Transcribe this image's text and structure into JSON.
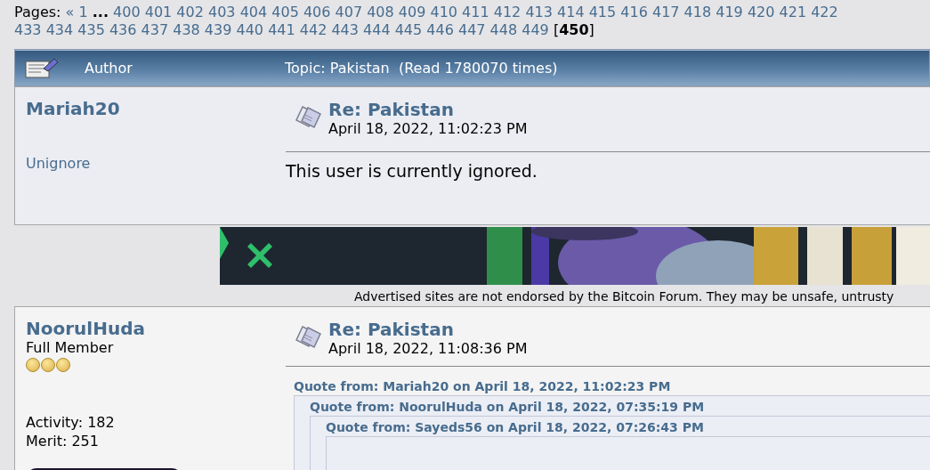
{
  "pagination": {
    "label": "Pages:",
    "first_link": "«",
    "lines": [
      [
        "1",
        "...",
        "400",
        "401",
        "402",
        "403",
        "404",
        "405",
        "406",
        "407",
        "408",
        "409",
        "410",
        "411",
        "412",
        "413",
        "414",
        "415",
        "416",
        "417",
        "418",
        "419",
        "420",
        "421",
        "422"
      ],
      [
        "433",
        "434",
        "435",
        "436",
        "437",
        "438",
        "439",
        "440",
        "441",
        "442",
        "443",
        "444",
        "445",
        "446",
        "447",
        "448",
        "449"
      ]
    ],
    "current": "[**450**]"
  },
  "topic_header": {
    "author_label": "Author",
    "topic": "Topic: Pakistan  (Read 1780070 times)"
  },
  "posts": [
    {
      "kind": "ignored",
      "author": "Mariah20",
      "unignore": "Unignore",
      "subject": "Re: Pakistan",
      "date": "April 18, 2022, 11:02:23 PM",
      "body": "This user is currently ignored."
    },
    {
      "kind": "full",
      "author": "NoorulHuda",
      "rank": "Full Member",
      "stars": 3,
      "activity": "Activity: 182",
      "merit": "Merit: 251",
      "subject": "Re: Pakistan",
      "date": "April 18, 2022, 11:08:36 PM",
      "quotes": [
        "Quote from: Mariah20 on April 18, 2022, 11:02:23 PM",
        "Quote from: NoorulHuda on April 18, 2022, 07:35:19 PM",
        "Quote from: Sayeds56 on April 18, 2022, 07:26:43 PM"
      ]
    }
  ],
  "ad": {
    "kind": "picture",
    "disclaimer": "Advertised sites are not endorsed by the Bitcoin Forum. They may be unsafe, untrusty"
  }
}
